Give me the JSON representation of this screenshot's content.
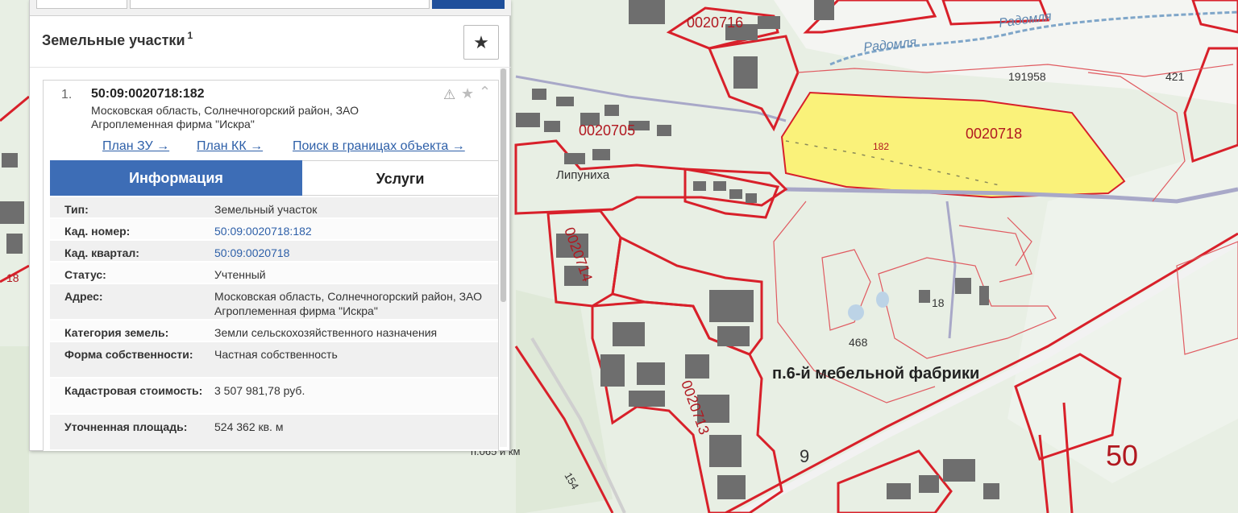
{
  "panel": {
    "title": "Земельные участки",
    "title_count": "1",
    "favorite_icon": "star-icon"
  },
  "result": {
    "index": "1.",
    "cadastral_number": "50:09:0020718:182",
    "address": "Московская область, Солнечногорский район, ЗАО Агроплеменная фирма \"Искра\"",
    "links": {
      "plan_zu": "План ЗУ →",
      "plan_kk": "План КК →",
      "search_in_bounds": "Поиск в границах объекта →"
    },
    "tabs": {
      "info": "Информация",
      "services": "Услуги"
    },
    "rows": [
      {
        "label": "Тип:",
        "value": "Земельный участок"
      },
      {
        "label": "Кад. номер:",
        "value": "50:09:0020718:182"
      },
      {
        "label": "Кад. квартал:",
        "value": "50:09:0020718"
      },
      {
        "label": "Статус:",
        "value": "Учтенный"
      },
      {
        "label": "Адрес:",
        "value": "Московская область, Солнечногорский район, ЗАО Агроплеменная фирма \"Искра\""
      },
      {
        "label": "Категория земель:",
        "value": "Земли сельскохозяйственного назначения"
      },
      {
        "label": "Форма собственности:",
        "value": "Частная собственность"
      },
      {
        "label": "Кадастровая стоимость:",
        "value": "3 507 981,78 руб."
      },
      {
        "label": "Уточненная площадь:",
        "value": "524 362 кв. м"
      }
    ]
  },
  "map": {
    "labels": {
      "q0020716": "0020716",
      "q0020705": "0020705",
      "q0020718": "0020718",
      "q0020714": "0020714",
      "q0020713": "0020713",
      "parcel_182": "182",
      "n191958": "191958",
      "n421": "421",
      "n468": "468",
      "n18_right": "18",
      "n18_left": "18",
      "n9": "9",
      "n50": "50",
      "n154": "154",
      "lipunikha": "Липуниха",
      "factory": "п.6-й мебельной фабрики",
      "river_1": "Радомля",
      "river_2": "Радомля",
      "station": "п.065 й км"
    },
    "colors": {
      "selected_fill": "#faf27a",
      "boundary": "#d8202a",
      "background": "#e8efe4"
    }
  }
}
